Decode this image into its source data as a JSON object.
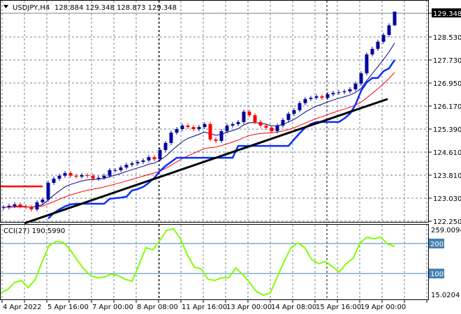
{
  "header": {
    "symbol": "USDJPY,H4",
    "ohlc": "128.884 129.348 128.873 129.348"
  },
  "colors": {
    "bull": "#0000a0",
    "bear": "#ff0000",
    "fast_ma": "#000080",
    "slow_ma": "#ff0000",
    "channel": "#0a2cff",
    "trendline": "#000000",
    "cci": "#7fff00",
    "cci_level": "#4682b4",
    "grid": "#708090"
  },
  "chart_data": {
    "type": "candlestick",
    "title": "USDJPY,H4",
    "y_ticks": [
      "129.348",
      "128.530",
      "127.730",
      "126.950",
      "126.170",
      "125.390",
      "124.610",
      "123.810",
      "123.030",
      "122.250"
    ],
    "ylim": [
      122.25,
      129.348
    ],
    "current_price": "129.348",
    "x_ticks": [
      {
        "index": 0,
        "label": "4 Apr 2022"
      },
      {
        "index": 8,
        "label": "5 Apr 16:00"
      },
      {
        "index": 16,
        "label": "7 Apr 00:00"
      },
      {
        "index": 24,
        "label": "8 Apr 08:00"
      },
      {
        "index": 32,
        "label": "11 Apr 16:00"
      },
      {
        "index": 40,
        "label": "13 Apr 00:00"
      },
      {
        "index": 48,
        "label": "14 Apr 08:00"
      },
      {
        "index": 56,
        "label": "15 Apr 16:00"
      },
      {
        "index": 64,
        "label": "19 Apr 00:00"
      }
    ],
    "first_open": 122.7,
    "last_candle": {
      "open": 128.884,
      "high": 129.348,
      "low": 128.873,
      "close": 129.348
    },
    "closes": [
      122.72,
      122.77,
      122.82,
      122.75,
      122.72,
      122.65,
      122.89,
      122.98,
      123.55,
      123.69,
      123.79,
      123.88,
      123.79,
      123.76,
      123.81,
      123.79,
      123.69,
      123.72,
      123.79,
      123.98,
      123.98,
      124.07,
      124.16,
      124.21,
      124.26,
      124.31,
      124.42,
      124.35,
      124.66,
      124.9,
      125.25,
      125.37,
      125.49,
      125.44,
      125.37,
      125.44,
      125.54,
      125.02,
      124.97,
      125.3,
      125.49,
      125.54,
      125.61,
      125.96,
      125.84,
      125.61,
      125.49,
      125.42,
      125.3,
      125.49,
      125.68,
      125.89,
      126.01,
      126.25,
      126.39,
      126.43,
      126.48,
      126.43,
      126.55,
      126.6,
      126.62,
      126.65,
      126.72,
      126.91,
      127.26,
      127.9,
      128.09,
      128.33,
      128.56,
      128.884,
      129.348
    ],
    "fast_ma_period": 8,
    "slow_ma_period": 21,
    "channel_start_index": 8,
    "channel": [
      122.34,
      122.53,
      122.65,
      122.75,
      122.82,
      122.84,
      122.84,
      122.84,
      122.84,
      122.84,
      122.84,
      123.01,
      123.03,
      123.05,
      123.08,
      123.29,
      123.34,
      123.41,
      123.55,
      123.72,
      123.95,
      124.12,
      124.26,
      124.4,
      124.4,
      124.4,
      124.4,
      124.4,
      124.4,
      124.4,
      124.4,
      124.4,
      124.4,
      124.4,
      124.8,
      124.8,
      124.8,
      124.8,
      124.8,
      124.8,
      124.8,
      124.8,
      124.8,
      124.8,
      125.02,
      125.23,
      125.42,
      125.54,
      125.61,
      125.61,
      125.61,
      125.61,
      125.61,
      125.73,
      125.89,
      126.2,
      126.67,
      126.95,
      127.1,
      127.1,
      127.33,
      127.43,
      127.71
    ],
    "trendline": {
      "from": {
        "index": 3.75,
        "price": 122.18
      },
      "to": {
        "index": 68.75,
        "price": 126.39
      }
    },
    "level_line": {
      "price": 123.43,
      "from_index": -0.6,
      "to_index": 7
    }
  },
  "cci": {
    "label": "CCI(27) 190.5990",
    "max_label": "259.0094",
    "min_label": "15.0204",
    "range": [
      15.0204,
      259.0094
    ],
    "levels": [
      {
        "value": 200,
        "label": "200"
      },
      {
        "value": 100,
        "label": "100"
      }
    ],
    "values": [
      35,
      47,
      70,
      77,
      53,
      81,
      140,
      193,
      207,
      205,
      181,
      147,
      116,
      93,
      86,
      88,
      98,
      93,
      81,
      74,
      128,
      186,
      179,
      209,
      244,
      249,
      216,
      163,
      121,
      116,
      81,
      77,
      86,
      86,
      119,
      98,
      70,
      40,
      28,
      35,
      88,
      140,
      186,
      202,
      186,
      147,
      133,
      140,
      123,
      105,
      133,
      151,
      202,
      221,
      216,
      221,
      198,
      190.599
    ]
  }
}
